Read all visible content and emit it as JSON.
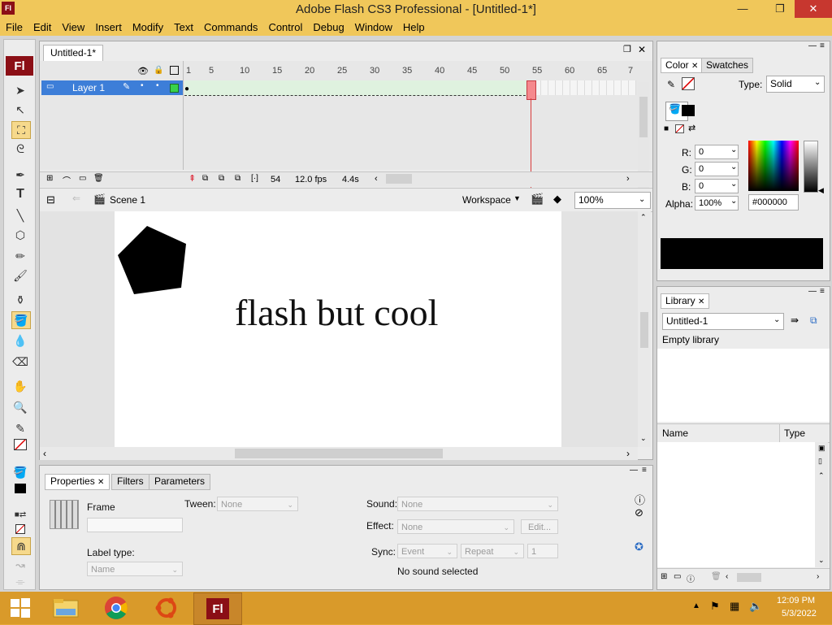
{
  "window": {
    "title": "Adobe Flash CS3 Professional - [Untitled-1*]",
    "app_badge": "Fl",
    "minimize": "—",
    "maximize": "❐",
    "close": "✕"
  },
  "menu": [
    "File",
    "Edit",
    "View",
    "Insert",
    "Modify",
    "Text",
    "Commands",
    "Control",
    "Debug",
    "Window",
    "Help"
  ],
  "tools": {
    "badge": "Fl"
  },
  "document": {
    "tab": "Untitled-1*"
  },
  "timeline": {
    "frame_ticks": [
      "1",
      "5",
      "10",
      "15",
      "20",
      "25",
      "30",
      "35",
      "40",
      "45",
      "50",
      "55",
      "60",
      "65",
      "7"
    ],
    "layer_name": "Layer 1",
    "current_frame": "54",
    "fps": "12.0 fps",
    "elapsed": "4.4s"
  },
  "editbar": {
    "scene": "Scene 1",
    "workspace": "Workspace",
    "zoom": "100%"
  },
  "stage": {
    "text": "flash but cool",
    "pentagon_color": "#000000"
  },
  "properties": {
    "tabs": [
      "Properties",
      "Filters",
      "Parameters"
    ],
    "frame_label": "Frame",
    "tween_label": "Tween:",
    "tween_value": "None",
    "label_type_label": "Label type:",
    "label_type_value": "Name",
    "sound_label": "Sound:",
    "sound_value": "None",
    "effect_label": "Effect:",
    "effect_value": "None",
    "edit_button": "Edit...",
    "sync_label": "Sync:",
    "sync_value": "Event",
    "repeat_value": "Repeat",
    "repeat_count": "1",
    "sound_status": "No sound selected"
  },
  "color_panel": {
    "tabs": [
      "Color",
      "Swatches"
    ],
    "type_label": "Type:",
    "type_value": "Solid",
    "r_label": "R:",
    "r_value": "0",
    "g_label": "G:",
    "g_value": "0",
    "b_label": "B:",
    "b_value": "0",
    "alpha_label": "Alpha:",
    "alpha_value": "100%",
    "hex_value": "#000000",
    "fill_color": "#000000"
  },
  "library_panel": {
    "tab": "Library",
    "document": "Untitled-1",
    "status": "Empty library",
    "col_name": "Name",
    "col_type": "Type"
  },
  "taskbar": {
    "time": "12:09 PM",
    "date": "5/3/2022",
    "flash_badge": "Fl"
  },
  "colors": {
    "titlebar": "#f0c75a",
    "taskbar": "#d99a2a",
    "flash_red": "#8b0f16",
    "selection_blue": "#3d7ed8",
    "playhead": "#d83a3a"
  }
}
